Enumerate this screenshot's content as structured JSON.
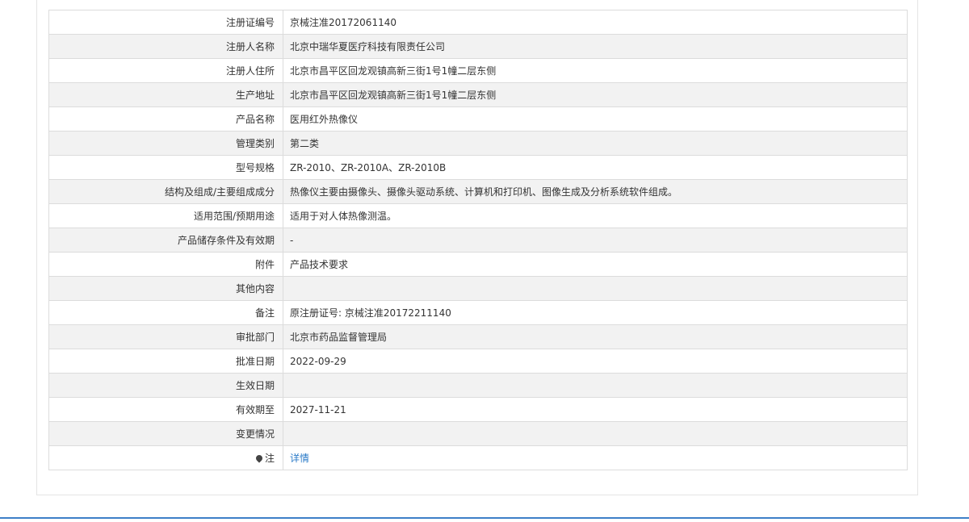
{
  "rows": [
    {
      "label": "注册证编号",
      "value": "京械注准20172061140"
    },
    {
      "label": "注册人名称",
      "value": "北京中瑞华夏医疗科技有限责任公司"
    },
    {
      "label": "注册人住所",
      "value": "北京市昌平区回龙观镇高新三街1号1幢二层东侧"
    },
    {
      "label": "生产地址",
      "value": "北京市昌平区回龙观镇高新三街1号1幢二层东侧"
    },
    {
      "label": "产品名称",
      "value": "医用红外热像仪"
    },
    {
      "label": "管理类别",
      "value": "第二类"
    },
    {
      "label": "型号规格",
      "value": "ZR-2010、ZR-2010A、ZR-2010B"
    },
    {
      "label": "结构及组成/主要组成成分",
      "value": "热像仪主要由摄像头、摄像头驱动系统、计算机和打印机、图像生成及分析系统软件组成。"
    },
    {
      "label": "适用范围/预期用途",
      "value": "适用于对人体热像测温。"
    },
    {
      "label": "产品储存条件及有效期",
      "value": "-"
    },
    {
      "label": "附件",
      "value": "产品技术要求"
    },
    {
      "label": "其他内容",
      "value": ""
    },
    {
      "label": "备注",
      "value": "原注册证号: 京械注准20172211140"
    },
    {
      "label": "审批部门",
      "value": "北京市药品监督管理局"
    },
    {
      "label": "批准日期",
      "value": "2022-09-29"
    },
    {
      "label": "生效日期",
      "value": ""
    },
    {
      "label": "有效期至",
      "value": "2027-11-21"
    },
    {
      "label": "变更情况",
      "value": ""
    }
  ],
  "note_row": {
    "label": "注",
    "link_text": "详情",
    "icon": "map-pin-icon"
  },
  "colors": {
    "link": "#2b7bc8",
    "stripe": "#f2f2f2",
    "border": "#dcdcdc",
    "footer_line": "#3d7fc8"
  }
}
